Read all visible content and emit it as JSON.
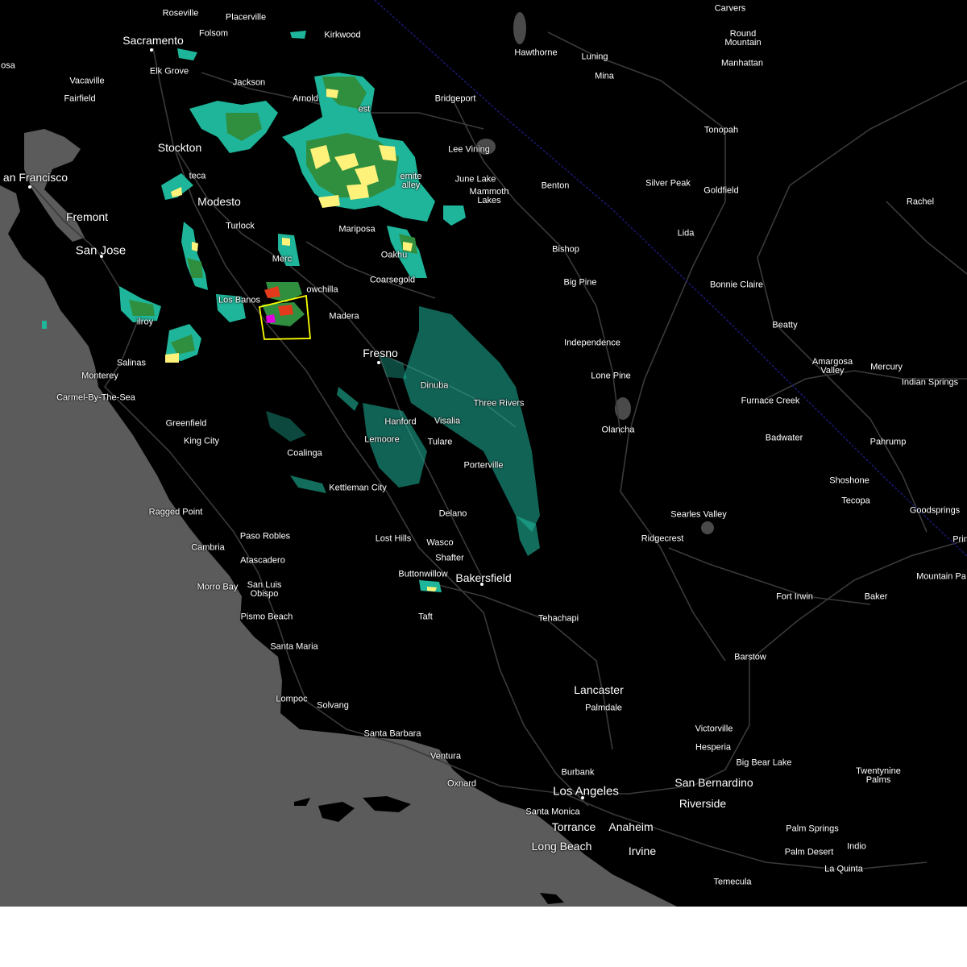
{
  "map": {
    "colors": {
      "land": "#000000",
      "ocean": "#5b5b5b",
      "roads": "#3a3a3a",
      "state_border": "#1a1a7a",
      "warning_box": "#ffff00",
      "radar_light": "#1fb59a",
      "radar_medium": "#2f8f3f",
      "radar_heavy": "#fff27a",
      "radar_severe": "#e23a1a",
      "radar_extreme": "#e000e0"
    },
    "labels": [
      {
        "id": "roseville",
        "text": "Roseville",
        "size": "normal"
      },
      {
        "id": "placerville",
        "text": "Placerville",
        "size": "normal"
      },
      {
        "id": "carvers",
        "text": "Carvers",
        "size": "normal"
      },
      {
        "id": "round-mountain",
        "text": "Round\nMountain",
        "size": "normal"
      },
      {
        "id": "manhattan",
        "text": "Manhattan",
        "size": "normal"
      },
      {
        "id": "sacramento",
        "text": "Sacramento",
        "size": "big"
      },
      {
        "id": "folsom",
        "text": "Folsom",
        "size": "normal"
      },
      {
        "id": "kirkwood",
        "text": "Kirkwood",
        "size": "normal"
      },
      {
        "id": "hawthorne",
        "text": "Hawthorne",
        "size": "normal"
      },
      {
        "id": "luning",
        "text": "Luning",
        "size": "normal"
      },
      {
        "id": "rosa",
        "text": "osa",
        "size": "normal"
      },
      {
        "id": "elk-grove",
        "text": "Elk Grove",
        "size": "normal"
      },
      {
        "id": "mina",
        "text": "Mina",
        "size": "normal"
      },
      {
        "id": "vacaville",
        "text": "Vacaville",
        "size": "normal"
      },
      {
        "id": "jackson",
        "text": "Jackson",
        "size": "normal"
      },
      {
        "id": "fairfield",
        "text": "Fairfield",
        "size": "normal"
      },
      {
        "id": "arnold",
        "text": "Arnold",
        "size": "normal"
      },
      {
        "id": "bridgeport",
        "text": "Bridgeport",
        "size": "normal"
      },
      {
        "id": "forest",
        "text": "est",
        "size": "normal"
      },
      {
        "id": "tonopah",
        "text": "Tonopah",
        "size": "normal"
      },
      {
        "id": "stockton",
        "text": "Stockton",
        "size": "big"
      },
      {
        "id": "lee-vining",
        "text": "Lee Vining",
        "size": "normal"
      },
      {
        "id": "san-francisco",
        "text": "an Francisco",
        "size": "big"
      },
      {
        "id": "manteca",
        "text": "teca",
        "size": "normal"
      },
      {
        "id": "yosemite-valley",
        "text": "emite\nalley",
        "size": "normal"
      },
      {
        "id": "june-lake",
        "text": "June Lake",
        "size": "normal"
      },
      {
        "id": "silver-peak",
        "text": "Silver Peak",
        "size": "normal"
      },
      {
        "id": "benton",
        "text": "Benton",
        "size": "normal"
      },
      {
        "id": "goldfield",
        "text": "Goldfield",
        "size": "normal"
      },
      {
        "id": "mammoth-lakes",
        "text": "Mammoth\nLakes",
        "size": "normal"
      },
      {
        "id": "modesto",
        "text": "Modesto",
        "size": "big"
      },
      {
        "id": "rachel",
        "text": "Rachel",
        "size": "normal"
      },
      {
        "id": "fremont",
        "text": "Fremont",
        "size": "big"
      },
      {
        "id": "turlock",
        "text": "Turlock",
        "size": "normal"
      },
      {
        "id": "mariposa",
        "text": "Mariposa",
        "size": "normal"
      },
      {
        "id": "lida",
        "text": "Lida",
        "size": "normal"
      },
      {
        "id": "san-jose",
        "text": "San Jose",
        "size": "huge"
      },
      {
        "id": "bishop",
        "text": "Bishop",
        "size": "normal"
      },
      {
        "id": "oakhurst",
        "text": "Oakhu",
        "size": "normal"
      },
      {
        "id": "merced",
        "text": "Merc",
        "size": "normal"
      },
      {
        "id": "coarsegold",
        "text": "Coarsegold",
        "size": "normal"
      },
      {
        "id": "big-pine",
        "text": "Big Pine",
        "size": "normal"
      },
      {
        "id": "bonnie-claire",
        "text": "Bonnie Claire",
        "size": "normal"
      },
      {
        "id": "chowchilla",
        "text": "owchilla",
        "size": "normal"
      },
      {
        "id": "los-banos",
        "text": "Los Banos",
        "size": "normal"
      },
      {
        "id": "madera",
        "text": "Madera",
        "size": "normal"
      },
      {
        "id": "gilroy",
        "text": "ilroy",
        "size": "normal"
      },
      {
        "id": "beatty",
        "text": "Beatty",
        "size": "normal"
      },
      {
        "id": "independence",
        "text": "Independence",
        "size": "normal"
      },
      {
        "id": "fresno",
        "text": "Fresno",
        "size": "big"
      },
      {
        "id": "amargosa-valley",
        "text": "Amargosa\nValley",
        "size": "normal"
      },
      {
        "id": "salinas",
        "text": "Salinas",
        "size": "normal"
      },
      {
        "id": "mercury",
        "text": "Mercury",
        "size": "normal"
      },
      {
        "id": "lone-pine",
        "text": "Lone Pine",
        "size": "normal"
      },
      {
        "id": "monterey",
        "text": "Monterey",
        "size": "normal"
      },
      {
        "id": "indian-springs",
        "text": "Indian Springs",
        "size": "normal"
      },
      {
        "id": "dinuba",
        "text": "Dinuba",
        "size": "normal"
      },
      {
        "id": "carmel",
        "text": "Carmel-By-The-Sea",
        "size": "normal"
      },
      {
        "id": "furnace-creek",
        "text": "Furnace Creek",
        "size": "normal"
      },
      {
        "id": "three-rivers",
        "text": "Three Rivers",
        "size": "normal"
      },
      {
        "id": "greenfield",
        "text": "Greenfield",
        "size": "normal"
      },
      {
        "id": "hanford",
        "text": "Hanford",
        "size": "normal"
      },
      {
        "id": "visalia",
        "text": "Visalia",
        "size": "normal"
      },
      {
        "id": "olancha",
        "text": "Olancha",
        "size": "normal"
      },
      {
        "id": "king-city",
        "text": "King City",
        "size": "normal"
      },
      {
        "id": "lemoore",
        "text": "Lemoore",
        "size": "normal"
      },
      {
        "id": "badwater",
        "text": "Badwater",
        "size": "normal"
      },
      {
        "id": "tulare",
        "text": "Tulare",
        "size": "normal"
      },
      {
        "id": "pahrump",
        "text": "Pahrump",
        "size": "normal"
      },
      {
        "id": "coalinga",
        "text": "Coalinga",
        "size": "normal"
      },
      {
        "id": "porterville",
        "text": "Porterville",
        "size": "normal"
      },
      {
        "id": "shoshone",
        "text": "Shoshone",
        "size": "normal"
      },
      {
        "id": "kettleman-city",
        "text": "Kettleman City",
        "size": "normal"
      },
      {
        "id": "tecopa",
        "text": "Tecopa",
        "size": "normal"
      },
      {
        "id": "ragged-point",
        "text": "Ragged Point",
        "size": "normal"
      },
      {
        "id": "goodsprings",
        "text": "Goodsprings",
        "size": "normal"
      },
      {
        "id": "delano",
        "text": "Delano",
        "size": "normal"
      },
      {
        "id": "searles-valley",
        "text": "Searles Valley",
        "size": "normal"
      },
      {
        "id": "paso-robles",
        "text": "Paso Robles",
        "size": "normal"
      },
      {
        "id": "lost-hills",
        "text": "Lost Hills",
        "size": "normal"
      },
      {
        "id": "ridgecrest",
        "text": "Ridgecrest",
        "size": "normal"
      },
      {
        "id": "primm",
        "text": "Prin",
        "size": "normal"
      },
      {
        "id": "wasco",
        "text": "Wasco",
        "size": "normal"
      },
      {
        "id": "cambria",
        "text": "Cambria",
        "size": "normal"
      },
      {
        "id": "shafter",
        "text": "Shafter",
        "size": "normal"
      },
      {
        "id": "atascadero",
        "text": "Atascadero",
        "size": "normal"
      },
      {
        "id": "buttonwillow",
        "text": "Buttonwillow",
        "size": "normal"
      },
      {
        "id": "bakersfield",
        "text": "Bakersfield",
        "size": "big"
      },
      {
        "id": "mountain-pass",
        "text": "Mountain Pa",
        "size": "normal"
      },
      {
        "id": "morro-bay",
        "text": "Morro Bay",
        "size": "normal"
      },
      {
        "id": "san-luis-obispo",
        "text": "San Luis\nObispo",
        "size": "normal"
      },
      {
        "id": "fort-irwin",
        "text": "Fort Irwin",
        "size": "normal"
      },
      {
        "id": "baker",
        "text": "Baker",
        "size": "normal"
      },
      {
        "id": "tehachapi",
        "text": "Tehachapi",
        "size": "normal"
      },
      {
        "id": "taft",
        "text": "Taft",
        "size": "normal"
      },
      {
        "id": "pismo-beach",
        "text": "Pismo Beach",
        "size": "normal"
      },
      {
        "id": "santa-maria",
        "text": "Santa Maria",
        "size": "normal"
      },
      {
        "id": "barstow",
        "text": "Barstow",
        "size": "normal"
      },
      {
        "id": "lancaster",
        "text": "Lancaster",
        "size": "big"
      },
      {
        "id": "lompoc",
        "text": "Lompoc",
        "size": "normal"
      },
      {
        "id": "solvang",
        "text": "Solvang",
        "size": "normal"
      },
      {
        "id": "palmdale",
        "text": "Palmdale",
        "size": "normal"
      },
      {
        "id": "victorville",
        "text": "Victorville",
        "size": "normal"
      },
      {
        "id": "santa-barbara",
        "text": "Santa Barbara",
        "size": "normal"
      },
      {
        "id": "hesperia",
        "text": "Hesperia",
        "size": "normal"
      },
      {
        "id": "ventura",
        "text": "Ventura",
        "size": "normal"
      },
      {
        "id": "big-bear-lake",
        "text": "Big Bear Lake",
        "size": "normal"
      },
      {
        "id": "twentynine-palms",
        "text": "Twentynine\nPalms",
        "size": "normal"
      },
      {
        "id": "burbank",
        "text": "Burbank",
        "size": "normal"
      },
      {
        "id": "san-bernardino",
        "text": "San Bernardino",
        "size": "big"
      },
      {
        "id": "oxnard",
        "text": "Oxnard",
        "size": "normal"
      },
      {
        "id": "los-angeles",
        "text": "Los Angeles",
        "size": "huge"
      },
      {
        "id": "riverside",
        "text": "Riverside",
        "size": "big"
      },
      {
        "id": "santa-monica",
        "text": "Santa Monica",
        "size": "normal"
      },
      {
        "id": "torrance",
        "text": "Torrance",
        "size": "big"
      },
      {
        "id": "anaheim",
        "text": "Anaheim",
        "size": "big"
      },
      {
        "id": "palm-springs",
        "text": "Palm Springs",
        "size": "normal"
      },
      {
        "id": "indio",
        "text": "Indio",
        "size": "normal"
      },
      {
        "id": "long-beach",
        "text": "Long Beach",
        "size": "big"
      },
      {
        "id": "irvine",
        "text": "Irvine",
        "size": "big"
      },
      {
        "id": "palm-desert",
        "text": "Palm Desert",
        "size": "normal"
      },
      {
        "id": "la-quinta",
        "text": "La Quinta",
        "size": "normal"
      },
      {
        "id": "temecula",
        "text": "Temecula",
        "size": "normal"
      }
    ]
  }
}
